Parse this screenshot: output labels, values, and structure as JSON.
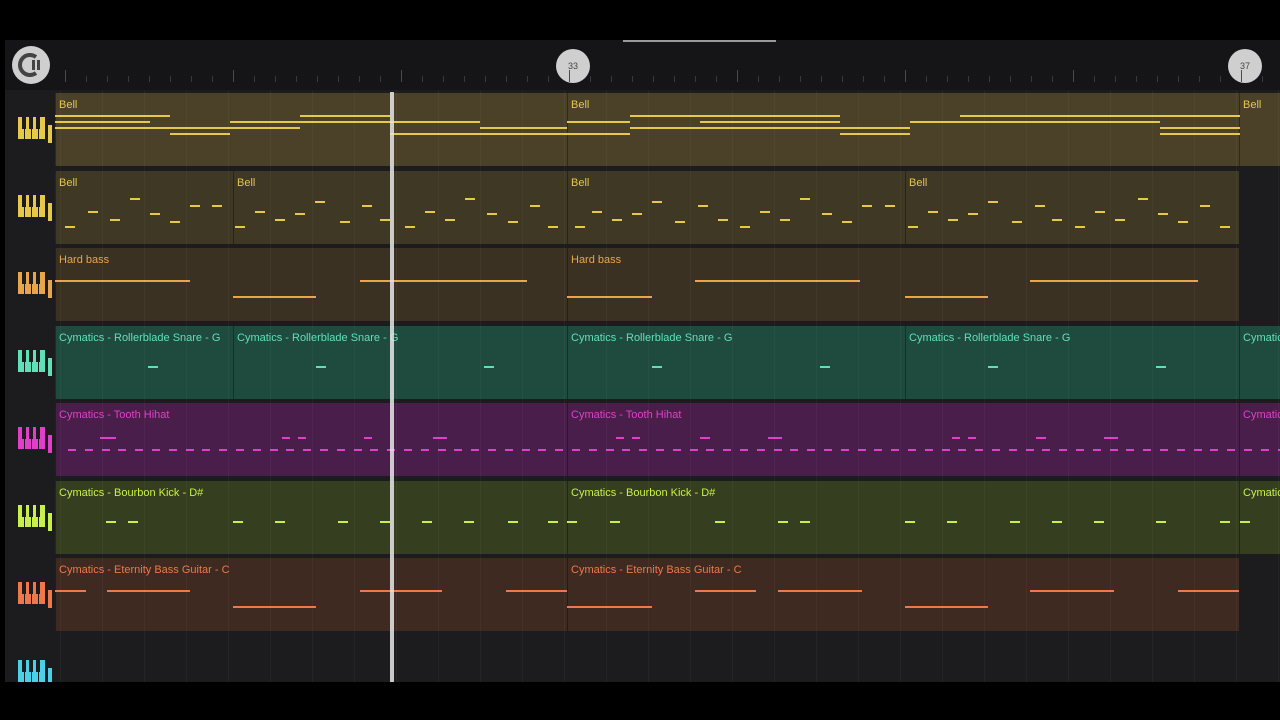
{
  "ruler": {
    "markers": [
      "33",
      "37"
    ]
  },
  "logo_icon": "daw-logo-icon",
  "tracks": [
    {
      "id": "bell-1",
      "color": "#e6c84a",
      "bg": "#4a4128",
      "clips": [
        {
          "label": "Bell",
          "start": 55,
          "end": 567
        },
        {
          "label": "Bell",
          "start": 567,
          "end": 1239
        },
        {
          "label": "Bell",
          "start": 1239,
          "end": 1280
        }
      ],
      "notes": [
        [
          55,
          170,
          22
        ],
        [
          55,
          150,
          28
        ],
        [
          55,
          150,
          34
        ],
        [
          150,
          230,
          34
        ],
        [
          170,
          230,
          40
        ],
        [
          230,
          300,
          28
        ],
        [
          230,
          300,
          34
        ],
        [
          300,
          390,
          22
        ],
        [
          300,
          390,
          28
        ],
        [
          390,
          480,
          28
        ],
        [
          480,
          567,
          34
        ],
        [
          390,
          567,
          40
        ],
        [
          567,
          630,
          28
        ],
        [
          567,
          630,
          40
        ],
        [
          630,
          840,
          22
        ],
        [
          630,
          840,
          34
        ],
        [
          700,
          840,
          28
        ],
        [
          840,
          910,
          40
        ],
        [
          840,
          910,
          34
        ],
        [
          910,
          1160,
          28
        ],
        [
          960,
          1240,
          22
        ],
        [
          1160,
          1240,
          34
        ],
        [
          1160,
          1240,
          40
        ]
      ]
    },
    {
      "id": "bell-2",
      "color": "#e6c84a",
      "bg": "#3e3824",
      "clips": [
        {
          "label": "Bell",
          "start": 55,
          "end": 233
        },
        {
          "label": "Bell",
          "start": 233,
          "end": 567
        },
        {
          "label": "Bell",
          "start": 567,
          "end": 905
        },
        {
          "label": "Bell",
          "start": 905,
          "end": 1239
        }
      ],
      "notes": [
        [
          65,
          75,
          55
        ],
        [
          88,
          98,
          40
        ],
        [
          110,
          120,
          48
        ],
        [
          130,
          140,
          27
        ],
        [
          150,
          160,
          42
        ],
        [
          170,
          180,
          50
        ],
        [
          190,
          200,
          34
        ],
        [
          212,
          222,
          34
        ],
        [
          235,
          245,
          55
        ],
        [
          255,
          265,
          40
        ],
        [
          275,
          285,
          48
        ],
        [
          295,
          305,
          42
        ],
        [
          315,
          325,
          30
        ],
        [
          340,
          350,
          50
        ],
        [
          362,
          372,
          34
        ],
        [
          380,
          390,
          48
        ],
        [
          405,
          415,
          55
        ],
        [
          425,
          435,
          40
        ],
        [
          445,
          455,
          48
        ],
        [
          465,
          475,
          27
        ],
        [
          487,
          497,
          42
        ],
        [
          508,
          518,
          50
        ],
        [
          530,
          540,
          34
        ],
        [
          548,
          558,
          55
        ],
        [
          575,
          585,
          55
        ],
        [
          592,
          602,
          40
        ],
        [
          612,
          622,
          48
        ],
        [
          632,
          642,
          42
        ],
        [
          652,
          662,
          30
        ],
        [
          675,
          685,
          50
        ],
        [
          698,
          708,
          34
        ],
        [
          718,
          728,
          48
        ],
        [
          740,
          750,
          55
        ],
        [
          760,
          770,
          40
        ],
        [
          780,
          790,
          48
        ],
        [
          800,
          810,
          27
        ],
        [
          822,
          832,
          42
        ],
        [
          842,
          852,
          50
        ],
        [
          862,
          872,
          34
        ],
        [
          885,
          895,
          34
        ],
        [
          908,
          918,
          55
        ],
        [
          928,
          938,
          40
        ],
        [
          948,
          958,
          48
        ],
        [
          968,
          978,
          42
        ],
        [
          988,
          998,
          30
        ],
        [
          1012,
          1022,
          50
        ],
        [
          1035,
          1045,
          34
        ],
        [
          1052,
          1062,
          48
        ],
        [
          1075,
          1085,
          55
        ],
        [
          1095,
          1105,
          40
        ],
        [
          1115,
          1125,
          48
        ],
        [
          1138,
          1148,
          27
        ],
        [
          1158,
          1168,
          42
        ],
        [
          1178,
          1188,
          50
        ],
        [
          1200,
          1210,
          34
        ],
        [
          1220,
          1230,
          55
        ]
      ]
    },
    {
      "id": "hard-bass",
      "color": "#e8a64a",
      "bg": "#3a3122",
      "clips": [
        {
          "label": "Hard bass",
          "start": 55,
          "end": 567
        },
        {
          "label": "Hard bass",
          "start": 567,
          "end": 1239
        }
      ],
      "notes": [
        [
          55,
          190,
          32
        ],
        [
          233,
          316,
          48
        ],
        [
          360,
          527,
          32
        ],
        [
          567,
          652,
          48
        ],
        [
          695,
          860,
          32
        ],
        [
          905,
          988,
          48
        ],
        [
          1030,
          1198,
          32
        ]
      ]
    },
    {
      "id": "snare",
      "color": "#5fe0b8",
      "bg": "#1f4a3e",
      "clips": [
        {
          "label": "Cymatics - Rollerblade Snare - G",
          "start": 55,
          "end": 233
        },
        {
          "label": "Cymatics - Rollerblade Snare - G",
          "start": 233,
          "end": 567
        },
        {
          "label": "Cymatics - Rollerblade Snare - G",
          "start": 567,
          "end": 905
        },
        {
          "label": "Cymatics - Rollerblade Snare - G",
          "start": 905,
          "end": 1239
        },
        {
          "label": "Cymatics - Rollerblade Snare - G",
          "start": 1239,
          "end": 1280
        }
      ],
      "notes": [
        [
          148,
          158,
          40
        ],
        [
          316,
          326,
          40
        ],
        [
          484,
          494,
          40
        ],
        [
          652,
          662,
          40
        ],
        [
          820,
          830,
          40
        ],
        [
          988,
          998,
          40
        ],
        [
          1156,
          1166,
          40
        ]
      ]
    },
    {
      "id": "hihat",
      "color": "#e040c8",
      "bg": "#4a1e4a",
      "clips": [
        {
          "label": "Cymatics - Tooth Hihat",
          "start": 55,
          "end": 567
        },
        {
          "label": "Cymatics - Tooth Hihat",
          "start": 567,
          "end": 1239
        },
        {
          "label": "Cymatics - Tooth Hihat",
          "start": 1239,
          "end": 1280
        }
      ],
      "notes": "hihat"
    },
    {
      "id": "kick",
      "color": "#c8f04a",
      "bg": "#363e20",
      "clips": [
        {
          "label": "Cymatics - Bourbon Kick - D#",
          "start": 55,
          "end": 567
        },
        {
          "label": "Cymatics - Bourbon Kick - D#",
          "start": 567,
          "end": 1239
        },
        {
          "label": "Cymatics - Bourbon Kick - D#",
          "start": 1239,
          "end": 1280
        }
      ],
      "notes": [
        [
          106,
          116,
          40
        ],
        [
          128,
          138,
          40
        ],
        [
          233,
          243,
          40
        ],
        [
          275,
          285,
          40
        ],
        [
          338,
          348,
          40
        ],
        [
          380,
          390,
          40
        ],
        [
          422,
          432,
          40
        ],
        [
          464,
          474,
          40
        ],
        [
          508,
          518,
          40
        ],
        [
          548,
          558,
          40
        ],
        [
          567,
          577,
          40
        ],
        [
          610,
          620,
          40
        ],
        [
          715,
          725,
          40
        ],
        [
          778,
          788,
          40
        ],
        [
          800,
          810,
          40
        ],
        [
          905,
          915,
          40
        ],
        [
          947,
          957,
          40
        ],
        [
          1010,
          1020,
          40
        ],
        [
          1052,
          1062,
          40
        ],
        [
          1094,
          1104,
          40
        ],
        [
          1156,
          1166,
          40
        ],
        [
          1220,
          1230,
          40
        ],
        [
          1240,
          1250,
          40
        ]
      ]
    },
    {
      "id": "bass-guitar",
      "color": "#f07848",
      "bg": "#3e2a20",
      "clips": [
        {
          "label": "Cymatics - Eternity Bass Guitar - C",
          "start": 55,
          "end": 567
        },
        {
          "label": "Cymatics - Eternity Bass Guitar - C",
          "start": 567,
          "end": 1239
        }
      ],
      "notes": [
        [
          55,
          86,
          32
        ],
        [
          107,
          190,
          32
        ],
        [
          233,
          316,
          48
        ],
        [
          360,
          442,
          32
        ],
        [
          506,
          567,
          32
        ],
        [
          567,
          652,
          48
        ],
        [
          695,
          756,
          32
        ],
        [
          778,
          862,
          32
        ],
        [
          905,
          988,
          48
        ],
        [
          1030,
          1114,
          32
        ],
        [
          1178,
          1239,
          32
        ]
      ]
    },
    {
      "id": "empty",
      "color": "#4ad0e8",
      "bg": "#1c1c1e",
      "clips": [],
      "notes": []
    }
  ]
}
